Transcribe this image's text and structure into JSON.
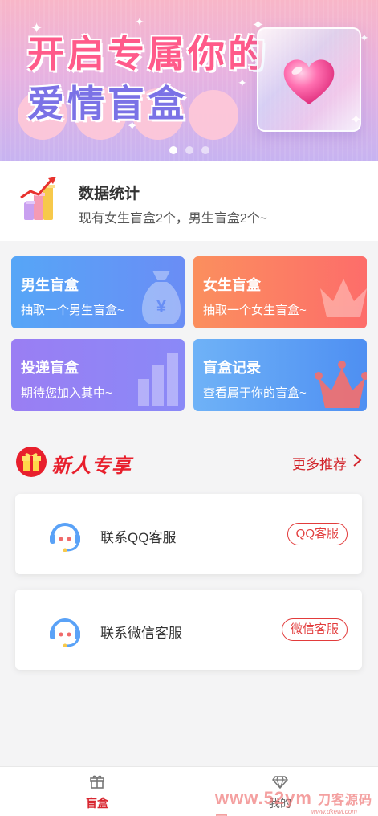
{
  "banner": {
    "line1": "开启专属你的",
    "line2": "爱情盲盒",
    "slides": 3,
    "active_slide": 1
  },
  "stats": {
    "title": "数据统计",
    "subtitle": "现有女生盲盒2个，男生盲盒2个~"
  },
  "cards": [
    {
      "title": "男生盲盒",
      "subtitle": "抽取一个男生盲盒~",
      "color": "#5aa2f7"
    },
    {
      "title": "女生盲盒",
      "subtitle": "抽取一个女生盲盒~",
      "color": "#fc7d62"
    },
    {
      "title": "投递盲盒",
      "subtitle": "期待您加入其中~",
      "color": "#937ff4"
    },
    {
      "title": "盲盒记录",
      "subtitle": "查看属于你的盲盒~",
      "color": "#5a9cf4"
    }
  ],
  "section": {
    "title": "新人专享",
    "more": "更多推荐",
    "accent": "#e81f2c"
  },
  "services": [
    {
      "label": "联系QQ客服",
      "button": "QQ客服"
    },
    {
      "label": "联系微信客服",
      "button": "微信客服"
    }
  ],
  "tabbar": {
    "items": [
      {
        "label": "盲盒",
        "icon": "gift-icon",
        "active": true
      },
      {
        "label": "我的",
        "icon": "diamond-icon",
        "active": false
      }
    ]
  },
  "watermark": {
    "text": "www.52ym",
    "suffix": "刀客源码网",
    "url": "www.dkewl.com"
  }
}
